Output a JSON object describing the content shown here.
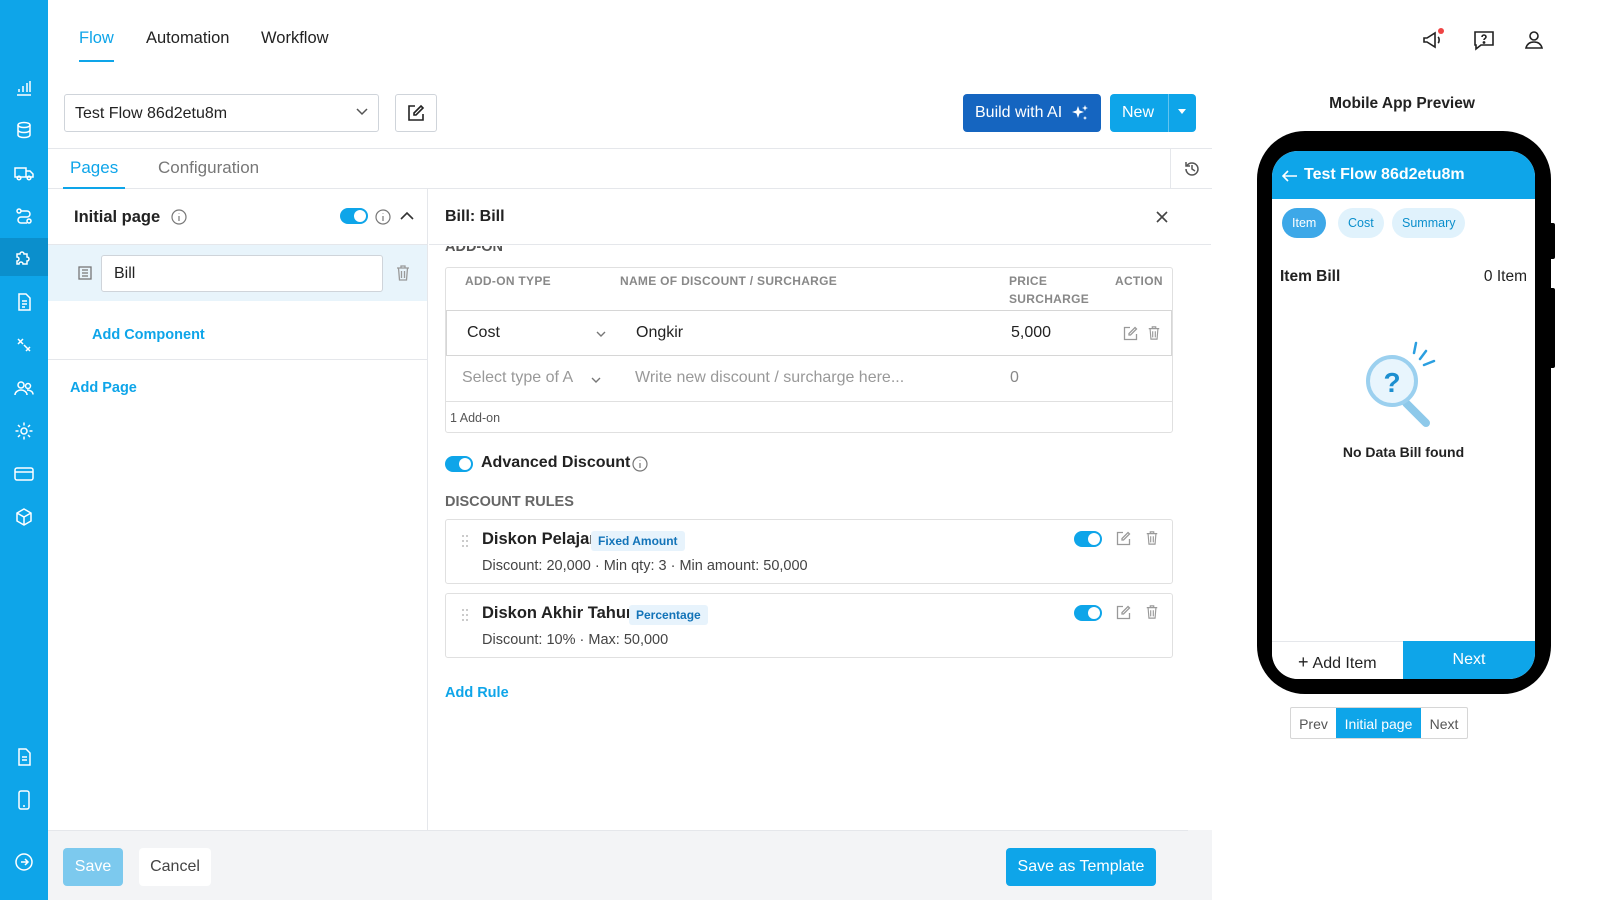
{
  "colors": {
    "accent": "#0ea5e9",
    "ai_button": "#1565c0",
    "rail": "#0ea5e9"
  },
  "sidebar": {
    "icons": [
      "chart-icon",
      "database-icon",
      "truck-icon",
      "route-icon",
      "puzzle-icon",
      "document-icon",
      "tools-icon",
      "users-icon",
      "gear-icon",
      "card-icon",
      "box-icon",
      "report-icon",
      "phone-icon",
      "logout-icon"
    ]
  },
  "topnav": {
    "tabs": [
      {
        "label": "Flow"
      },
      {
        "label": "Automation"
      },
      {
        "label": "Workflow"
      }
    ],
    "icons": [
      "megaphone-icon",
      "help-chat-icon",
      "user-icon"
    ]
  },
  "toolbar": {
    "flow_select": "Test Flow 86d2etu8m",
    "build_ai": "Build with AI",
    "new": "New"
  },
  "page_tabs": [
    {
      "label": "Pages"
    },
    {
      "label": "Configuration"
    }
  ],
  "pages_panel": {
    "initial_page_title": "Initial page",
    "component_value": "Bill",
    "add_component": "Add Component",
    "add_page": "Add Page"
  },
  "detail": {
    "title": "Bill: Bill",
    "addon_section": "ADD-ON",
    "table": {
      "headers": {
        "type": "ADD-ON TYPE",
        "name": "NAME OF DISCOUNT / SURCHARGE",
        "price_1": "PRICE",
        "price_2": "SURCHARGE",
        "action": "ACTION"
      },
      "rows": [
        {
          "type": "Cost",
          "name": "Ongkir",
          "price": "5,000"
        }
      ],
      "new_row": {
        "type_placeholder": "Select type of A",
        "name_placeholder": "Write new discount / surcharge here...",
        "price": "0"
      },
      "footer": "1 Add-on"
    },
    "advanced_discount": "Advanced Discount",
    "discount_rules_label": "DISCOUNT RULES",
    "rules": [
      {
        "name": "Diskon Pelajar",
        "badge": "Fixed Amount",
        "desc": "Discount: 20,000 · Min qty: 3 · Min amount: 50,000"
      },
      {
        "name": "Diskon Akhir Tahun",
        "badge": "Percentage",
        "desc": "Discount: 10% · Max: 50,000"
      }
    ],
    "add_rule": "Add Rule"
  },
  "footer": {
    "save": "Save",
    "cancel": "Cancel",
    "save_template": "Save as Template"
  },
  "preview": {
    "title": "Mobile App Preview",
    "screen_title": "Test Flow 86d2etu8m",
    "chips": [
      {
        "label": "Item"
      },
      {
        "label": "Cost"
      },
      {
        "label": "Summary"
      }
    ],
    "item_bill": "Item Bill",
    "item_count": "0 Item",
    "empty": "No Data Bill found",
    "add_item": "Add Item",
    "next": "Next",
    "pager": {
      "prev": "Prev",
      "current": "Initial page",
      "next": "Next"
    }
  }
}
